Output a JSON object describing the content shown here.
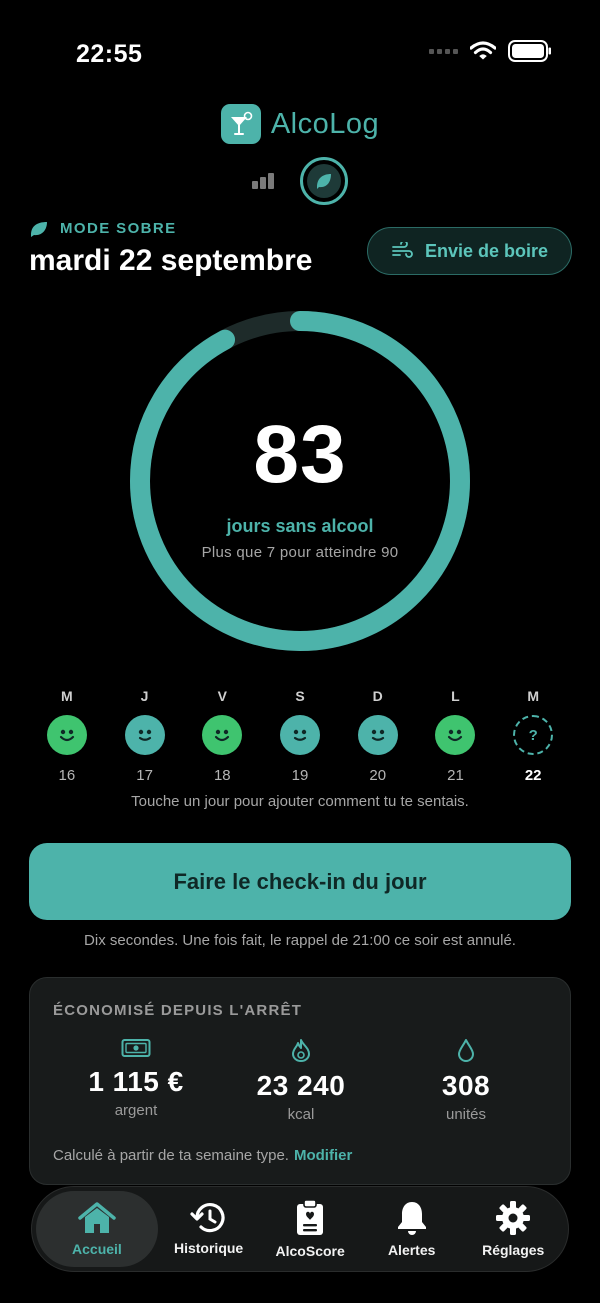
{
  "status_bar": {
    "time": "22:55"
  },
  "app": {
    "name": "AlcoLog"
  },
  "header": {
    "mode_label": "MODE SOBRE",
    "date": "mardi 22 septembre",
    "craving_button": "Envie de boire"
  },
  "progress": {
    "days": "83",
    "label": "jours sans alcool",
    "hint": "Plus que 7 pour atteindre 90",
    "goal": 90,
    "fraction": 0.922
  },
  "week": {
    "days": [
      {
        "letter": "M",
        "num": "16",
        "mood": "good"
      },
      {
        "letter": "J",
        "num": "17",
        "mood": "ok"
      },
      {
        "letter": "V",
        "num": "18",
        "mood": "good"
      },
      {
        "letter": "S",
        "num": "19",
        "mood": "ok"
      },
      {
        "letter": "D",
        "num": "20",
        "mood": "ok"
      },
      {
        "letter": "L",
        "num": "21",
        "mood": "good"
      },
      {
        "letter": "M",
        "num": "22",
        "mood": "unknown",
        "mark": "?"
      }
    ],
    "hint": "Touche un jour pour ajouter comment tu te sentais."
  },
  "checkin": {
    "button": "Faire le check-in du jour",
    "note": "Dix secondes. Une fois fait, le rappel de 21:00 ce soir est annulé."
  },
  "savings": {
    "title": "ÉCONOMISÉ DEPUIS L'ARRÊT",
    "stats": [
      {
        "icon": "money-icon",
        "value": "1 115 €",
        "unit": "argent"
      },
      {
        "icon": "flame-icon",
        "value": "23 240",
        "unit": "kcal"
      },
      {
        "icon": "drop-icon",
        "value": "308",
        "unit": "unités"
      }
    ],
    "footnote": "Calculé à partir de ta semaine type.",
    "link": "Modifier"
  },
  "tabs": [
    {
      "label": "Accueil",
      "icon": "home-icon",
      "active": true
    },
    {
      "label": "Historique",
      "icon": "history-icon"
    },
    {
      "label": "AlcoScore",
      "icon": "clipboard-icon"
    },
    {
      "label": "Alertes",
      "icon": "bell-icon"
    },
    {
      "label": "Réglages",
      "icon": "gear-icon"
    }
  ],
  "colors": {
    "accent": "#4db3aa",
    "good_mood": "#3fc46f",
    "background": "#000000",
    "card": "#181b1b"
  }
}
